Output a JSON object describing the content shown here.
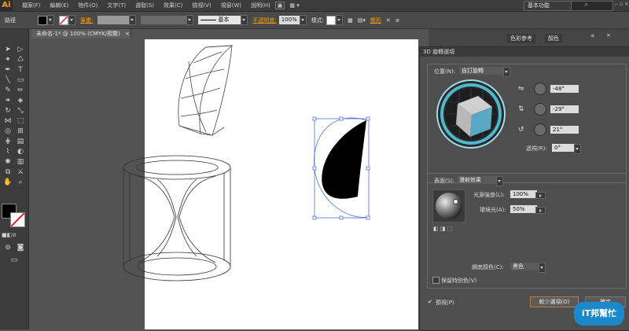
{
  "app": {
    "logo": "Ai"
  },
  "menubar": {
    "items": [
      "檔案(F)",
      "編輯(E)",
      "物件(O)",
      "文字(T)",
      "選取(S)",
      "效果(C)",
      "檢視(V)",
      "視窗(W)",
      "說明(H)"
    ],
    "workspace": "基本功能",
    "search_placeholder": ""
  },
  "controlbar": {
    "label": "路徑",
    "stroke_label": "筆畫:",
    "stroke_style": "基本",
    "opacity_label": "不透明度:",
    "opacity_value": "100%",
    "style_label": "樣式:",
    "transform_label": "變形"
  },
  "document": {
    "tab_title": "未命名-1* @ 100% (CMYK/預覽)"
  },
  "panels": {
    "color_ref": "色彩參考",
    "color": "顏色"
  },
  "dialog": {
    "title": "3D 旋轉選項",
    "position_label": "位置(N):",
    "position_value": "自訂旋轉",
    "x_angle": "-48°",
    "y_angle": "-29°",
    "z_angle": "21°",
    "perspective_label": "透視(R):",
    "perspective_value": "0°",
    "surface_label": "表面(S):",
    "surface_value": "漫射效果",
    "light_intensity_label": "光源強度(L):",
    "light_intensity_value": "100%",
    "ambient_label": "環境光(A):",
    "ambient_value": "50%",
    "shading_label": "網底顏色(C):",
    "shading_value": "黑色",
    "preserve_spot_label": "保留特別色(V)",
    "preview_label": "預視(P)",
    "fewer_options_button": "較少選項(O)",
    "ok_button": "確定",
    "cube_colors": {
      "top": "#cfcfcf",
      "left": "#b8b8b8",
      "right": "#5aa7c4",
      "ring": "#4fb8cc"
    }
  },
  "watermark": {
    "text": "iT邦幫忙"
  }
}
